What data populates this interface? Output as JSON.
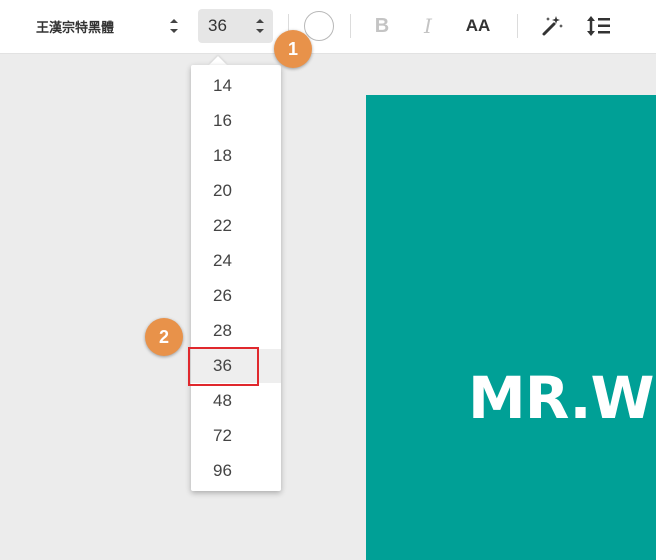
{
  "toolbar": {
    "font_family": "王漢宗特黑體",
    "font_size": "36",
    "bold_label": "B",
    "italic_label": "I",
    "caps_label": "AA",
    "icons": {
      "updown": "updown-arrows-icon",
      "effects": "magic-wand-icon",
      "spacing": "line-spacing-icon"
    }
  },
  "size_dropdown": {
    "options": [
      "14",
      "16",
      "18",
      "20",
      "22",
      "24",
      "26",
      "28",
      "36",
      "48",
      "72",
      "96"
    ],
    "selected": "36"
  },
  "badges": {
    "first": "1",
    "second": "2"
  },
  "canvas": {
    "text": "MR.W"
  },
  "colors": {
    "canvas_bg": "#00a096",
    "badge": "#e8924a",
    "highlight": "#e0282d",
    "workspace": "#ececec"
  }
}
